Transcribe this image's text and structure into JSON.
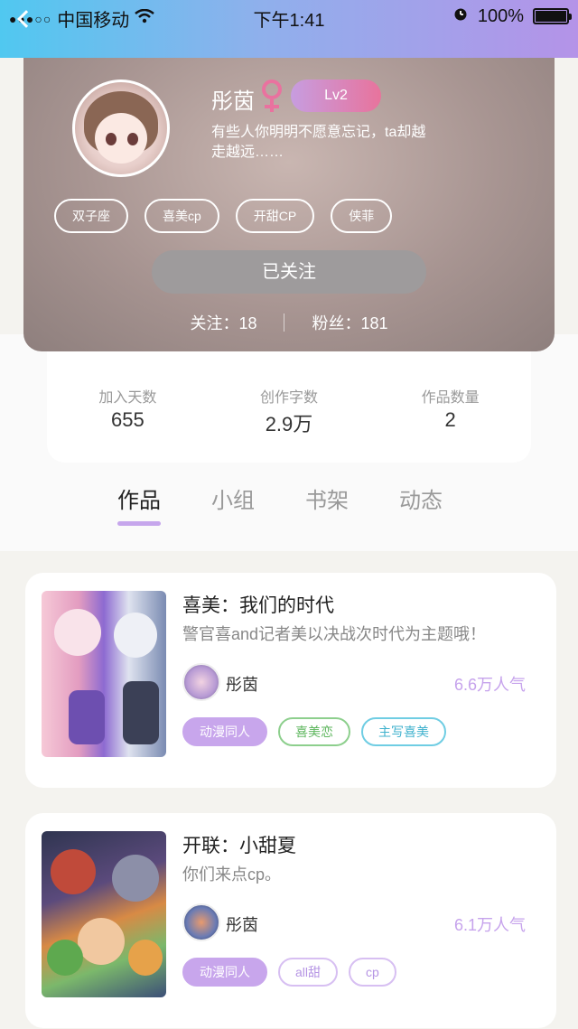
{
  "status_bar": {
    "carrier": "中国移动",
    "time": "下午1:41",
    "battery": "100%"
  },
  "profile": {
    "name": "彤茵",
    "level": "Lv2",
    "bio": "有些人你明明不愿意忘记，ta却越走越远……",
    "tags": [
      "双子座",
      "喜美cp",
      "开甜CP",
      "侠菲"
    ],
    "follow_button": "已关注",
    "following": "关注：18",
    "fans": "粉丝：181"
  },
  "stats": [
    {
      "label": "加入天数",
      "value": "655"
    },
    {
      "label": "创作字数",
      "value": "2.9万"
    },
    {
      "label": "作品数量",
      "value": "2"
    }
  ],
  "tabs": [
    {
      "label": "作品",
      "active": true
    },
    {
      "label": "小组",
      "active": false
    },
    {
      "label": "书架",
      "active": false
    },
    {
      "label": "动态",
      "active": false
    }
  ],
  "works": [
    {
      "title": "喜美：我们的时代",
      "desc": "警官喜and记者美以决战次时代为主题哦！",
      "author": "彤茵",
      "popularity": "6.6万人气",
      "tags": [
        "动漫同人",
        "喜美恋",
        "主写喜美"
      ]
    },
    {
      "title": "开联：小甜夏",
      "desc": "你们来点cp。",
      "author": "彤茵",
      "popularity": "6.1万人气",
      "tags": [
        "动漫同人",
        "all甜",
        "cp"
      ]
    }
  ],
  "colors": {
    "accent": "#c6a6ec",
    "header_gradient_start": "#50c8f0",
    "header_gradient_end": "#b493e8",
    "female": "#e9729f"
  }
}
